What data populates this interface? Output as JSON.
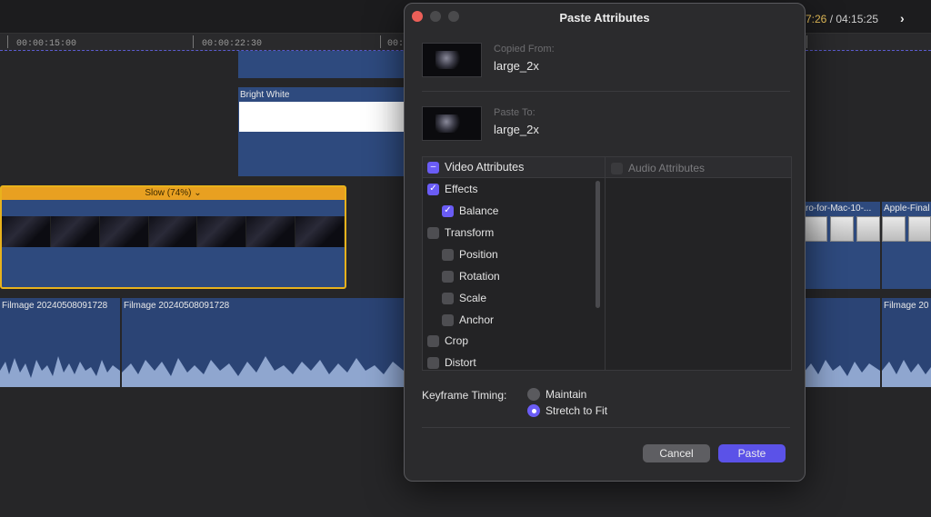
{
  "timeline": {
    "top_timecode_played": "7:26",
    "top_timecode_sep": " / ",
    "top_timecode_total": "04:15:25",
    "ruler_ticks": [
      "00:00:15:00",
      "00:00:22:30",
      "00:"
    ],
    "generator_clip_label": "Bright White",
    "speed_label": "Slow (74%) ⌄",
    "audio_clip_labels": [
      "Filmage 20240508091728",
      "Filmage 20240508091728",
      "Filmage 20"
    ],
    "right_clip_labels": [
      "ro-for-Mac-10-...",
      "Apple-Final"
    ]
  },
  "dialog": {
    "title": "Paste Attributes",
    "copied_from_label": "Copied From:",
    "copied_from_value": "large_2x",
    "paste_to_label": "Paste To:",
    "paste_to_value": "large_2x",
    "video_attributes_label": "Video Attributes",
    "audio_attributes_label": "Audio Attributes",
    "video_items": [
      {
        "label": "Effects",
        "checked": true,
        "indent": 0
      },
      {
        "label": "Balance",
        "checked": true,
        "indent": 1
      },
      {
        "label": "Transform",
        "checked": false,
        "indent": 0
      },
      {
        "label": "Position",
        "checked": false,
        "indent": 1
      },
      {
        "label": "Rotation",
        "checked": false,
        "indent": 1
      },
      {
        "label": "Scale",
        "checked": false,
        "indent": 1
      },
      {
        "label": "Anchor",
        "checked": false,
        "indent": 1
      },
      {
        "label": "Crop",
        "checked": false,
        "indent": 0
      },
      {
        "label": "Distort",
        "checked": false,
        "indent": 0
      }
    ],
    "keyframe_timing_label": "Keyframe Timing:",
    "keyframe_options": [
      "Maintain",
      "Stretch to Fit"
    ],
    "keyframe_selected": "Stretch to Fit",
    "cancel_label": "Cancel",
    "paste_label": "Paste"
  },
  "colors": {
    "accent": "#6a5cf5",
    "selection_border": "#e8b21c",
    "clip_blue": "#2e4a7e"
  }
}
